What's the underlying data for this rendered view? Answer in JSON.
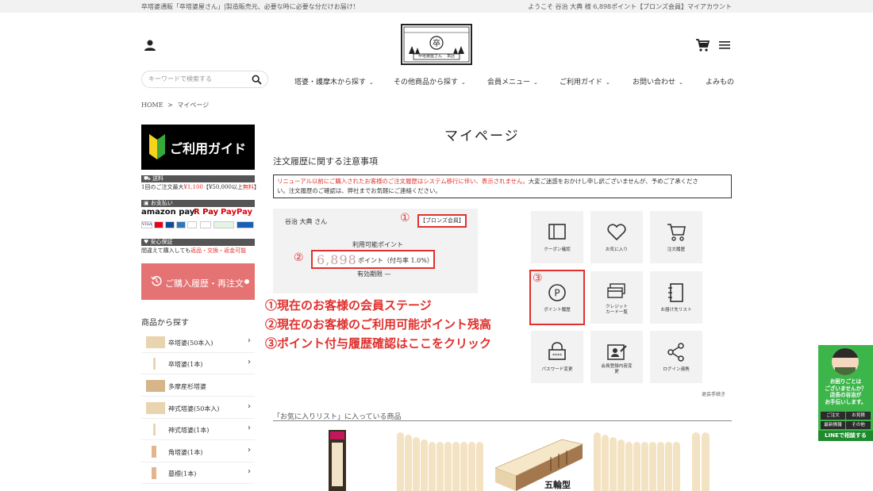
{
  "topbar": {
    "tagline": "卒塔婆通販「卒塔婆屋さん」|製造販売元、必要な時に必要な分だけお届け!",
    "greeting": "ようこそ 谷治 大典 様 6,898ポイント【ブロンズ会員】マイアカウント"
  },
  "logo": {
    "name": "卒塔婆屋さん",
    "sub": "本店"
  },
  "search": {
    "placeholder": "キーワードで検索する"
  },
  "nav": [
    {
      "label": "塔婆・護摩木から探す"
    },
    {
      "label": "その他商品から探す"
    },
    {
      "label": "会員メニュー"
    },
    {
      "label": "ご利用ガイド"
    },
    {
      "label": "お問い合わせ"
    },
    {
      "label": "よみもの"
    }
  ],
  "breadcrumb": {
    "home": "HOME",
    "sep": ">",
    "current": "マイページ"
  },
  "sidebar": {
    "guide_banner": "ご利用ガイド",
    "shipping": {
      "head": "送料",
      "line_a": "1回のご注文最大",
      "line_b": "¥1,100",
      "line_c": "【¥50,000以上",
      "line_d": "無料",
      "line_e": "】"
    },
    "payment": {
      "head": "お支払い",
      "amazon": "amazon pay",
      "rpay": "R Pay",
      "paypay": "PayPay"
    },
    "guarantee": {
      "head": "安心保証",
      "line_a": "間違えて購入しても",
      "line_b": "返品・交換・返金可能"
    },
    "history_button": "ご購入履歴・再注文",
    "categories_heading": "商品から探す",
    "categories": [
      {
        "label": "卒塔婆(50本入)"
      },
      {
        "label": "卒塔婆(1本)"
      },
      {
        "label": "多摩産杉塔婆"
      },
      {
        "label": "神式塔婆(50本入)"
      },
      {
        "label": "神式塔婆(1本)"
      },
      {
        "label": "角塔婆(1本)"
      },
      {
        "label": "墓標(1本)"
      }
    ]
  },
  "main": {
    "title": "マイページ",
    "notice_title": "注文履歴に関する注意事項",
    "notice_red": "リニューアル以前にご購入されたお客様のご注文履歴はシステム移行に伴い、表示されません。",
    "notice_rest_a": "大変ご迷惑をおかけし申し訳ございませんが、予めご了承くださ",
    "notice_rest_b": "い。注文履歴のご確認は、弊社までお気軽にご連絡ください。",
    "member": {
      "name": "谷治 大典 さん",
      "rank": "【ブロンズ会員】",
      "points_label": "利用可能ポイント",
      "points_value": "6,898",
      "points_unit": "ポイント（付与率 1.0%）",
      "expiry": "有効期限 —"
    },
    "annotations": {
      "num1": "①",
      "num2": "②",
      "num3": "③",
      "line1": "①現在のお客様の会員ステージ",
      "line2": "②現在のお客様のご利用可能ポイント残高",
      "line3": "③ポイント付与履歴確認はここをクリック"
    },
    "tiles": [
      {
        "label": "クーポン確認",
        "icon": "book-icon"
      },
      {
        "label": "お気に入り",
        "icon": "heart-icon"
      },
      {
        "label": "注文履歴",
        "icon": "cart-icon"
      },
      {
        "label": "ポイント履歴",
        "icon": "point-icon"
      },
      {
        "label": "クレジット\nカード一覧",
        "icon": "card-icon"
      },
      {
        "label": "お届け先リスト",
        "icon": "notebook-icon"
      },
      {
        "label": "パスワード変更",
        "icon": "lock-icon"
      },
      {
        "label": "会員登録内容変\n更",
        "icon": "profile-icon"
      },
      {
        "label": "ログイン連携",
        "icon": "share-icon"
      }
    ],
    "withdraw": "退会手続き",
    "favorites_title": "「お気に入りリスト」に入っている商品",
    "product_label": "五輪型"
  },
  "line_widget": {
    "msg": "お困りごとは\nございませんか？\n店長の谷治が\nお手伝いします。",
    "b1": "ご注文",
    "b2": "お見積",
    "b3": "最新情報",
    "b4": "その他",
    "cta": "LINEで相談する"
  },
  "colors": {
    "accent_red": "#e0312e",
    "history_button": "#e57373",
    "line_green": "#3cb54a"
  }
}
